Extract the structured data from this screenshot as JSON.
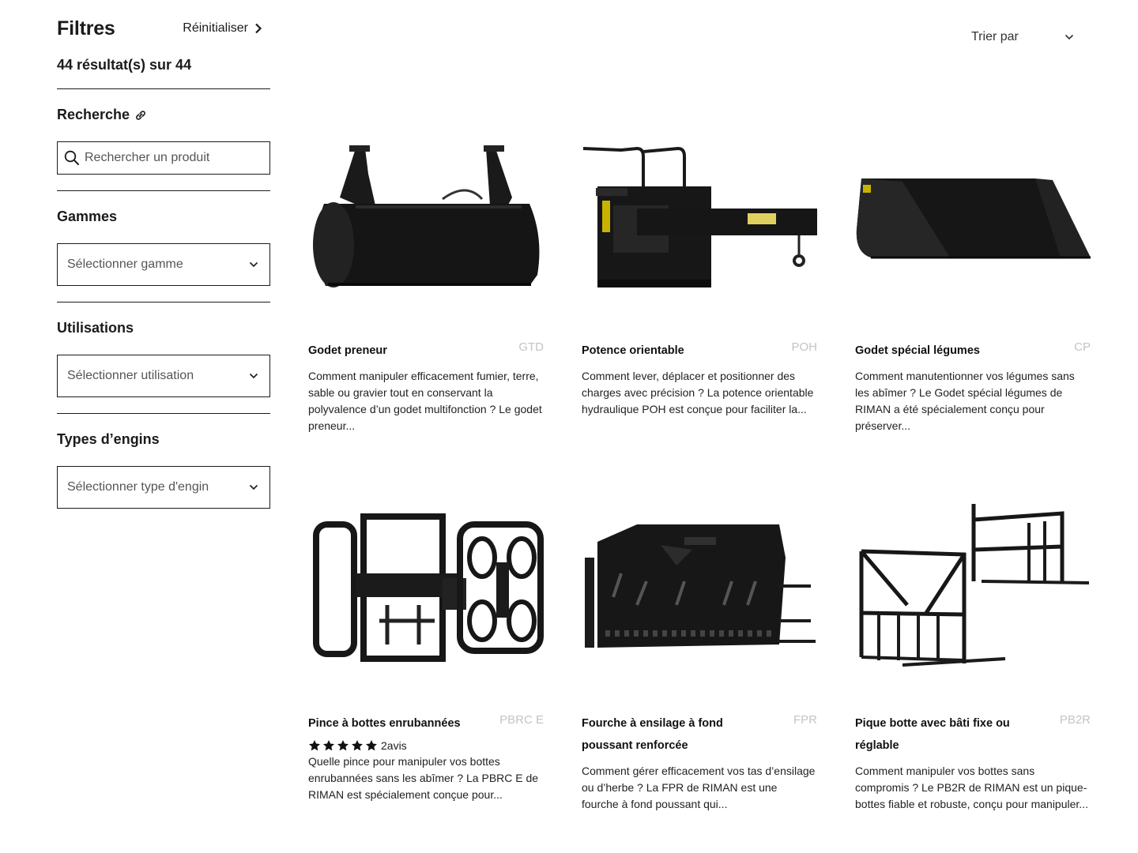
{
  "filters": {
    "title": "Filtres",
    "reset_label": "Réinitialiser",
    "results_count": "44 résultat(s) sur 44",
    "search_section_title": "Recherche",
    "search_placeholder": "Rechercher un produit",
    "gammes": {
      "title": "Gammes",
      "placeholder": "Sélectionner gamme"
    },
    "utilisations": {
      "title": "Utilisations",
      "placeholder": "Sélectionner utilisation"
    },
    "types": {
      "title": "Types d’engins",
      "placeholder": "Sélectionner type d'engin"
    }
  },
  "sort": {
    "label": "Trier par"
  },
  "products": [
    {
      "title": "Godet preneur",
      "code": "GTD",
      "description": "Comment manipuler efficacement fumier, terre, sable ou gravier tout en conservant la polyvalence d’un godet multifonction ? Le godet preneur..."
    },
    {
      "title": "Potence orientable",
      "code": "POH",
      "description": "Comment lever, déplacer et positionner des charges avec précision ? La potence orientable hydraulique POH est conçue pour faciliter la..."
    },
    {
      "title": "Godet spécial légumes",
      "code": "CP",
      "description": "Comment manutentionner vos légumes sans les abîmer ? Le Godet spécial légumes de RIMAN a été spécialement conçu pour préserver..."
    },
    {
      "title": "Pince à bottes enrubannées",
      "code": "PBRC E",
      "rating_stars": 5,
      "reviews_label": "2avis",
      "description": "Quelle pince pour manipuler vos bottes enrubannées sans les abîmer ? La PBRC E de RIMAN est spécialement conçue pour..."
    },
    {
      "title": "Fourche à ensilage à fond poussant renforcée",
      "code": "FPR",
      "description": "Comment gérer efficacement vos tas d’ensilage ou d’herbe ? La FPR de RIMAN est une fourche à fond poussant qui..."
    },
    {
      "title": "Pique botte avec bâti fixe ou réglable",
      "code": "PB2R",
      "description": "Comment manipuler vos bottes sans compromis ? Le PB2R de RIMAN est un pique-bottes fiable et robuste, conçu pour manipuler..."
    }
  ]
}
